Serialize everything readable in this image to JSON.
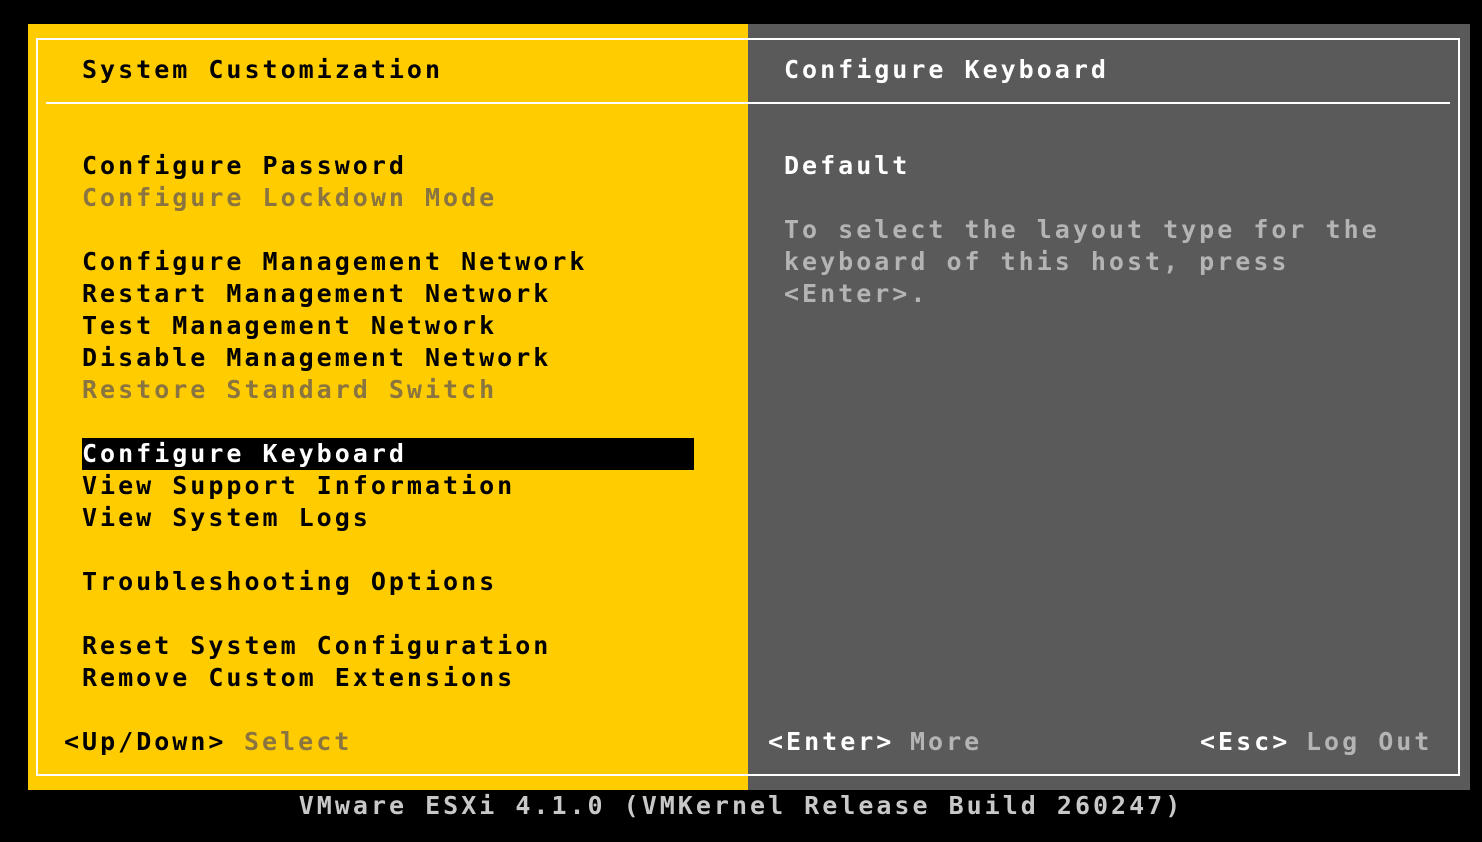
{
  "colors": {
    "left_bg": "#FFCC00",
    "right_bg": "#5A5A5A",
    "screen_bg": "#000000",
    "selection_bg": "#000000",
    "text_active": "#000000",
    "text_disabled": "#8A7440",
    "text_right": "#FFFFFF",
    "text_right_dim": "#B4B4B4"
  },
  "left": {
    "title": "System Customization",
    "menu": [
      {
        "label": "Configure Password",
        "enabled": true
      },
      {
        "label": "Configure Lockdown Mode",
        "enabled": false
      },
      {
        "label": "Configure Management Network",
        "enabled": true
      },
      {
        "label": "Restart Management Network",
        "enabled": true
      },
      {
        "label": "Test Management Network",
        "enabled": true
      },
      {
        "label": "Disable Management Network",
        "enabled": true
      },
      {
        "label": "Restore Standard Switch",
        "enabled": false
      },
      {
        "label": "Configure Keyboard",
        "enabled": true,
        "selected": true
      },
      {
        "label": "View Support Information",
        "enabled": true
      },
      {
        "label": "View System Logs",
        "enabled": true
      },
      {
        "label": "Troubleshooting Options",
        "enabled": true
      },
      {
        "label": "Reset System Configuration",
        "enabled": true
      },
      {
        "label": "Remove Custom Extensions",
        "enabled": true
      }
    ],
    "hint_key": "<Up/Down>",
    "hint_action": "Select"
  },
  "right": {
    "title": "Configure Keyboard",
    "value": "Default",
    "description": [
      "To select the layout type for the",
      "keyboard of this host, press",
      "<Enter>."
    ],
    "hint_enter_key": "<Enter>",
    "hint_enter_action": "More",
    "hint_esc_key": "<Esc>",
    "hint_esc_action": "Log Out"
  },
  "status_bar": "VMware ESXi 4.1.0 (VMKernel Release Build 260247)"
}
